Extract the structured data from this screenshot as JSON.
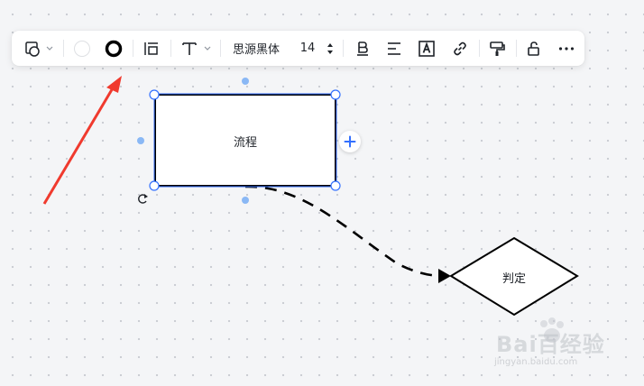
{
  "toolbar": {
    "font_family_label": "思源黑体",
    "font_size_value": "14",
    "icons": [
      "shape-style-icon",
      "fill-color-icon",
      "border-style-icon",
      "layout-icon",
      "text-style-icon",
      "bold-underline-icon",
      "align-icon",
      "text-background-icon",
      "link-icon",
      "format-painter-icon",
      "unlock-icon",
      "more-icon"
    ]
  },
  "canvas": {
    "process_label": "流程",
    "decision_label": "判定"
  },
  "colors": {
    "selection": "#3370ff",
    "handle_fill": "#8ab8f5",
    "annotation_arrow": "#f03a2e",
    "stroke": "#000000",
    "add_plus": "#3370ff"
  },
  "watermark": {
    "main": "Bai百经验",
    "sub": "jingyan.baidu.com"
  }
}
